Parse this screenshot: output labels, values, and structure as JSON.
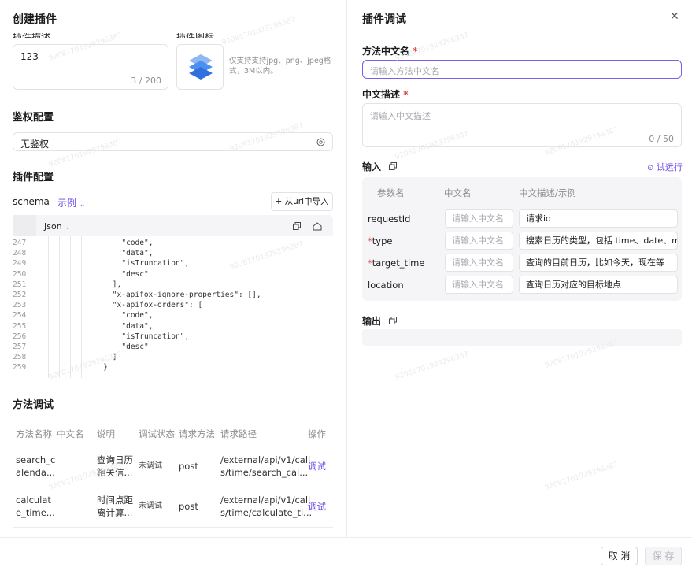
{
  "left": {
    "title": "创建插件",
    "desc_label": "插件描述",
    "icon_label": "插件图标",
    "desc_value": "123",
    "desc_count": "3 / 200",
    "upload_hint": "仅支持支持jpg、png、jpeg格式，3M以内。",
    "auth_title": "鉴权配置",
    "auth_value": "无鉴权",
    "plugin_config_title": "插件配置",
    "schema_label": "schema",
    "example_label": "示例",
    "import_button": "+ 从url中导入",
    "format_select": "Json",
    "code_lines": [
      {
        "n": "247",
        "t": "\"code\",",
        "indent": 18,
        "str": true
      },
      {
        "n": "248",
        "t": "\"data\",",
        "indent": 18,
        "str": true
      },
      {
        "n": "249",
        "t": "\"isTruncation\",",
        "indent": 18,
        "str": true
      },
      {
        "n": "250",
        "t": "\"desc\"",
        "indent": 18,
        "str": true
      },
      {
        "n": "251",
        "t": "],",
        "indent": 16,
        "str": false
      },
      {
        "n": "252",
        "t": "\"x-apifox-ignore-properties\": [],",
        "indent": 16,
        "str": false
      },
      {
        "n": "253",
        "t": "\"x-apifox-orders\": [",
        "indent": 16,
        "str": false
      },
      {
        "n": "254",
        "t": "\"code\",",
        "indent": 18,
        "str": true
      },
      {
        "n": "255",
        "t": "\"data\",",
        "indent": 18,
        "str": true
      },
      {
        "n": "256",
        "t": "\"isTruncation\",",
        "indent": 18,
        "str": true
      },
      {
        "n": "257",
        "t": "\"desc\"",
        "indent": 18,
        "str": true
      },
      {
        "n": "258",
        "t": "]",
        "indent": 16,
        "str": false
      },
      {
        "n": "259",
        "t": "}",
        "indent": 14,
        "str": false
      }
    ],
    "method_debug_title": "方法调试",
    "table_headers": [
      "方法名称",
      "中文名",
      "说明",
      "调试状态",
      "请求方法",
      "请求路径",
      "操作"
    ],
    "table_rows": [
      {
        "name": "search_c\nalenda...",
        "cn": "",
        "desc": "查询日历\n相关信...",
        "status": "未调试",
        "method": "post",
        "path": "/external/api/v1/call\ns/time/search_cal...",
        "action": "调试"
      },
      {
        "name": "calculat\ne_time...",
        "cn": "",
        "desc": "时间点距\n离计算...",
        "status": "未调试",
        "method": "post",
        "path": "/external/api/v1/call\ns/time/calculate_ti...",
        "action": "调试"
      }
    ]
  },
  "right": {
    "title": "插件调试",
    "method_cn_label": "方法中文名",
    "method_cn_placeholder": "请输入方法中文名",
    "cn_desc_label": "中文描述",
    "cn_desc_placeholder": "请输入中文描述",
    "cn_desc_count": "0 / 50",
    "input_title": "输入",
    "try_run": "试运行",
    "input_headers": [
      "参数名",
      "中文名",
      "中文描述/示例"
    ],
    "input_rows": [
      {
        "param": "requestId",
        "required": false,
        "cn_placeholder": "请输入中文名",
        "desc": "请求id"
      },
      {
        "param": "type",
        "required": true,
        "cn_placeholder": "请输入中文名",
        "desc": "搜索日历的类型，包括 time、date、moi"
      },
      {
        "param": "target_time",
        "required": true,
        "cn_placeholder": "请输入中文名",
        "desc": "查询的目前日历，比如今天，现在等"
      },
      {
        "param": "location",
        "required": false,
        "cn_placeholder": "请输入中文名",
        "desc": "查询日历对应的目标地点"
      }
    ],
    "output_title": "输出",
    "required_mark": "*"
  },
  "footer": {
    "cancel": "取 消",
    "save": "保 存"
  },
  "colors": {
    "accent": "#6b47e6",
    "required": "#e0413d",
    "panel_bg": "#f5f5f7"
  }
}
